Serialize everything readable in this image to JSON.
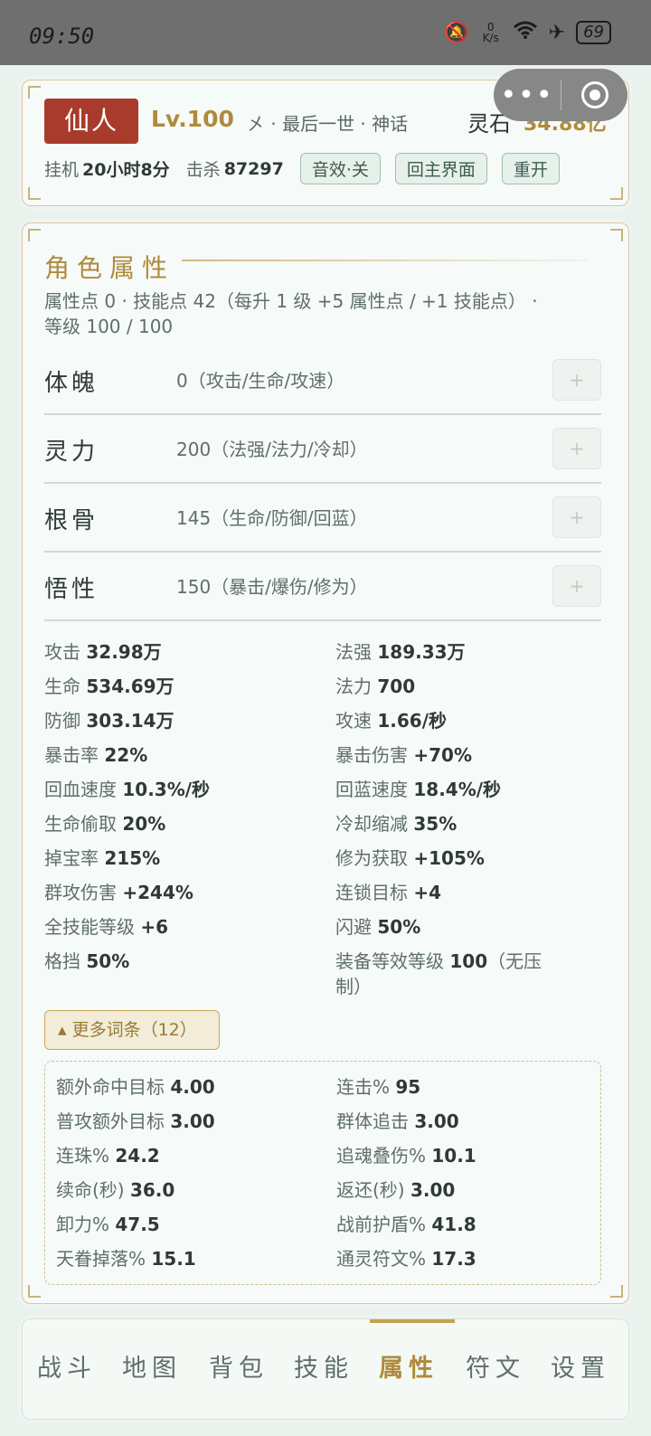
{
  "status": {
    "time": "09:50",
    "net_speed_top": "0",
    "net_speed_unit": "K/s",
    "battery": "69"
  },
  "header": {
    "realm": "仙人",
    "level": "Lv.100",
    "sub": "㐅 · 最后一世 · 神话",
    "gold_label": "灵石",
    "gold_value": "34.88亿",
    "idle_label": "挂机",
    "idle_value": "20小时8分",
    "kill_label": "击杀",
    "kill_value": "87297",
    "sound_button": "音效·关",
    "home_button": "回主界面",
    "restart_button": "重开"
  },
  "attributes": {
    "title": "角色属性",
    "points_line1": "属性点 0 · 技能点 42（每升 1 级 +5 属性点 / +1 技能点） ·",
    "points_line2": "等级 100 / 100",
    "alloc": [
      {
        "name": "体魄",
        "value": "0（攻击/生命/攻速）",
        "plus": "+"
      },
      {
        "name": "灵力",
        "value": "200（法强/法力/冷却）",
        "plus": "+"
      },
      {
        "name": "根骨",
        "value": "145（生命/防御/回蓝）",
        "plus": "+"
      },
      {
        "name": "悟性",
        "value": "150（暴击/爆伤/修为）",
        "plus": "+"
      }
    ],
    "stats": [
      {
        "label": "攻击",
        "value": "32.98万"
      },
      {
        "label": "法强",
        "value": "189.33万"
      },
      {
        "label": "生命",
        "value": "534.69万"
      },
      {
        "label": "法力",
        "value": "700"
      },
      {
        "label": "防御",
        "value": "303.14万"
      },
      {
        "label": "攻速",
        "value": "1.66/秒"
      },
      {
        "label": "暴击率",
        "value": "22%"
      },
      {
        "label": "暴击伤害",
        "value": "+70%"
      },
      {
        "label": "回血速度",
        "value": "10.3%/秒"
      },
      {
        "label": "回蓝速度",
        "value": "18.4%/秒"
      },
      {
        "label": "生命偷取",
        "value": "20%"
      },
      {
        "label": "冷却缩减",
        "value": "35%"
      },
      {
        "label": "掉宝率",
        "value": "215%"
      },
      {
        "label": "修为获取",
        "value": "+105%"
      },
      {
        "label": "群攻伤害",
        "value": "+244%"
      },
      {
        "label": "连锁目标",
        "value": "+4"
      },
      {
        "label": "全技能等级",
        "value": "+6"
      },
      {
        "label": "闪避",
        "value": "50%"
      },
      {
        "label": "格挡",
        "value": "50%"
      },
      {
        "label": "装备等效等级",
        "value": "100",
        "suffix": "（无压",
        "suffix2": "制）"
      }
    ],
    "more_button": "▴ 更多词条（12）",
    "extra": [
      {
        "label": "额外命中目标",
        "value": "4.00"
      },
      {
        "label": "连击%",
        "value": "95"
      },
      {
        "label": "普攻额外目标",
        "value": "3.00"
      },
      {
        "label": "群体追击",
        "value": "3.00"
      },
      {
        "label": "连珠%",
        "value": "24.2"
      },
      {
        "label": "追魂叠伤%",
        "value": "10.1"
      },
      {
        "label": "续命(秒)",
        "value": "36.0"
      },
      {
        "label": "返还(秒)",
        "value": "3.00"
      },
      {
        "label": "卸力%",
        "value": "47.5"
      },
      {
        "label": "战前护盾%",
        "value": "41.8"
      },
      {
        "label": "天眷掉落%",
        "value": "15.1"
      },
      {
        "label": "通灵符文%",
        "value": "17.3"
      }
    ]
  },
  "tabs": [
    "战斗",
    "地图",
    "背包",
    "技能",
    "属性",
    "符文",
    "设置"
  ],
  "active_tab": "属性"
}
